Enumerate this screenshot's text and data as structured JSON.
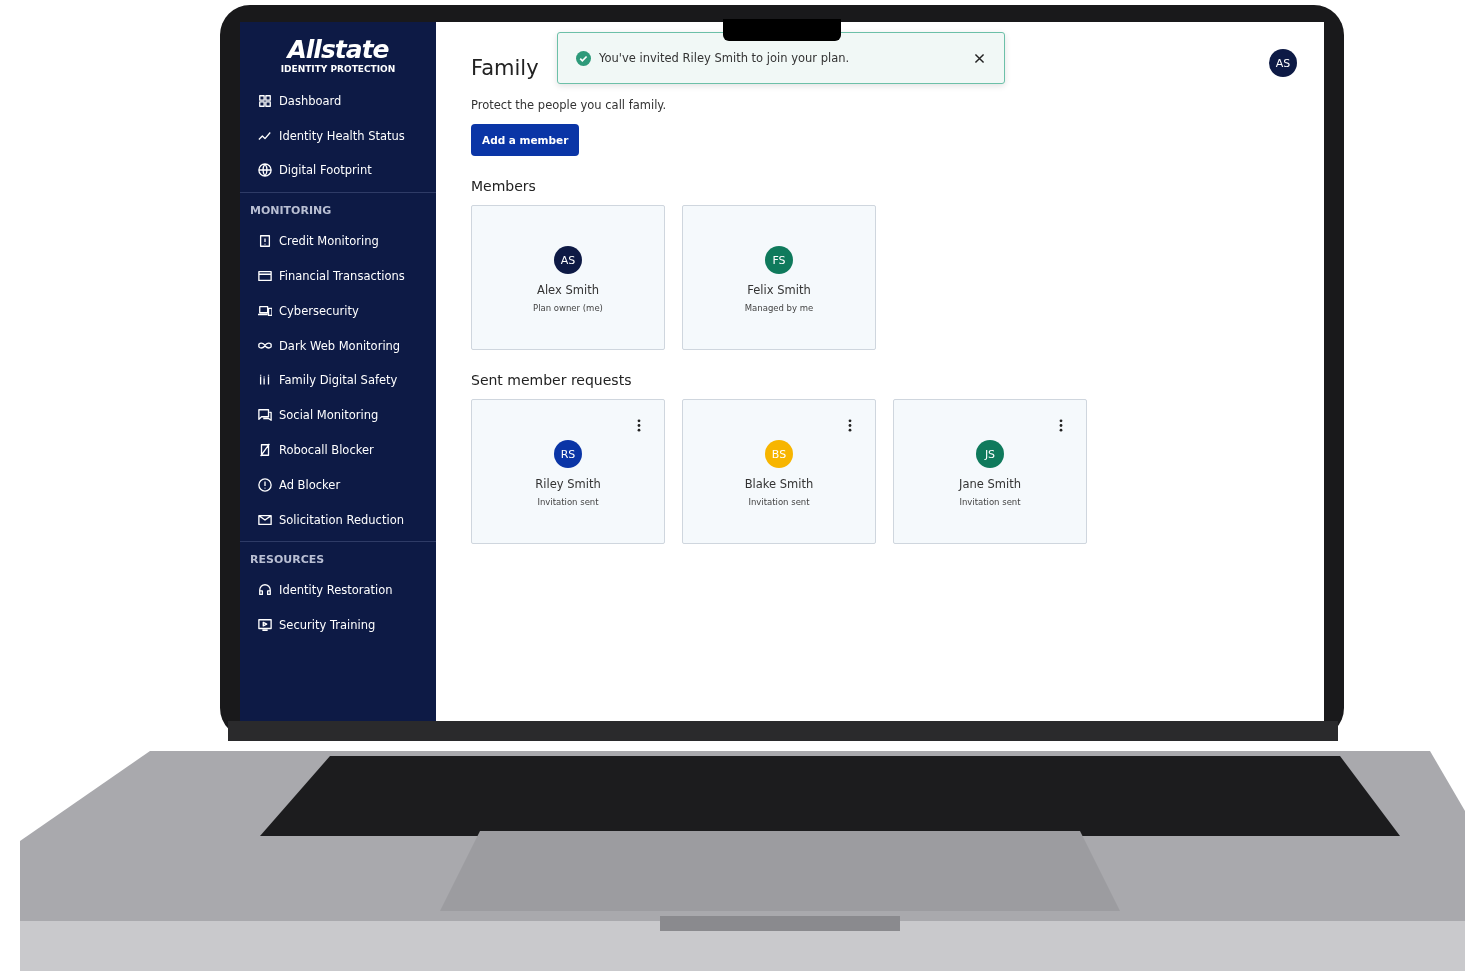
{
  "sidebar": {
    "logo": {
      "name": "Allstate",
      "tagline": "IDENTITY PROTECTION"
    },
    "sections": [
      {
        "items": [
          {
            "label": "Dashboard"
          },
          {
            "label": "Identity Health Status"
          },
          {
            "label": "Digital Footprint"
          }
        ]
      },
      {
        "heading": "MONITORING",
        "items": [
          {
            "label": "Credit Monitoring"
          },
          {
            "label": "Financial Transactions"
          },
          {
            "label": "Cybersecurity"
          },
          {
            "label": "Dark Web Monitoring"
          },
          {
            "label": "Family Digital Safety"
          },
          {
            "label": "Social Monitoring"
          },
          {
            "label": "Robocall Blocker"
          },
          {
            "label": "Ad Blocker"
          },
          {
            "label": "Solicitation Reduction"
          }
        ]
      },
      {
        "heading": "RESOURCES",
        "items": [
          {
            "label": "Identity Restoration"
          },
          {
            "label": "Security Training"
          }
        ]
      }
    ]
  },
  "toast": {
    "message": "You've invited Riley Smith to join your plan."
  },
  "header": {
    "title": "Family",
    "user_initials": "AS"
  },
  "subtitle": "Protect the people you call family.",
  "add_button": "Add a member",
  "members": {
    "heading": "Members",
    "cards": [
      {
        "initials": "AS",
        "name": "Alex Smith",
        "role": "Plan owner (me)",
        "color": "#0e1a45"
      },
      {
        "initials": "FS",
        "name": "Felix Smith",
        "role": "Managed by me",
        "color": "#0f7a5c"
      }
    ]
  },
  "requests": {
    "heading": "Sent member requests",
    "cards": [
      {
        "initials": "RS",
        "name": "Riley Smith",
        "role": "Invitation sent",
        "color": "#0a35a6"
      },
      {
        "initials": "BS",
        "name": "Blake Smith",
        "role": "Invitation sent",
        "color": "#f7b500"
      },
      {
        "initials": "JS",
        "name": "Jane Smith",
        "role": "Invitation sent",
        "color": "#0f7a5c"
      }
    ]
  }
}
